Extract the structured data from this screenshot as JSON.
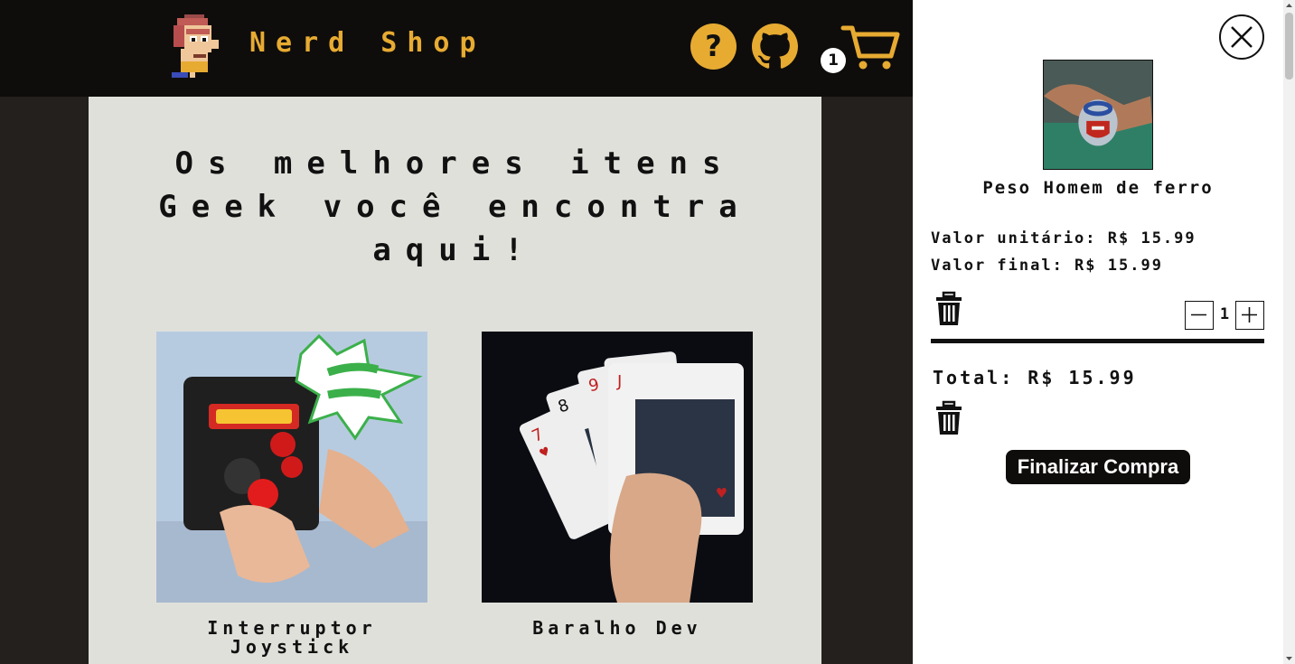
{
  "header": {
    "brand": "Nerd Shop",
    "help_label": "?",
    "cart_count": "1"
  },
  "main": {
    "headline": "Os melhores itens Geek você encontra aqui!",
    "products": [
      {
        "title": "Interruptor Joystick"
      },
      {
        "title": "Baralho Dev"
      }
    ]
  },
  "cart": {
    "item_name": "Peso Homem de ferro",
    "unit_price": "Valor unitário: R$ 15.99",
    "final_price": "Valor final: R$ 15.99",
    "quantity": "1",
    "total": "Total: R$ 15.99",
    "checkout_label": "Finalizar Compra"
  },
  "colors": {
    "accent": "#e7ab32",
    "header_bg": "#0f0d0b",
    "page_bg": "#23201e",
    "content_bg": "#e0e0db"
  },
  "icons": [
    "pixel-avatar-logo",
    "help-icon",
    "github-icon",
    "cart-icon",
    "close-icon",
    "trash-icon",
    "minus-icon",
    "plus-icon"
  ]
}
